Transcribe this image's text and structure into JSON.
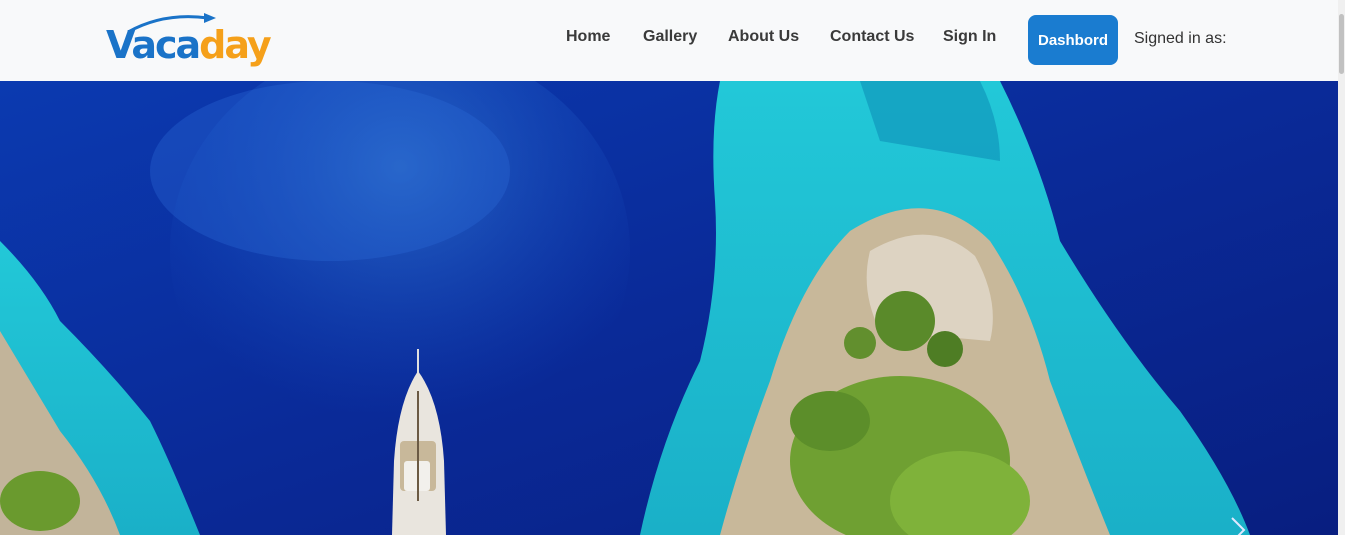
{
  "brand": {
    "name_part1": "Vaca",
    "name_part2": "day",
    "colors": {
      "primary": "#1a73c8",
      "accent": "#f5a01a"
    }
  },
  "nav": {
    "links": [
      "Home",
      "Gallery",
      "About Us",
      "Contact Us",
      "Sign In"
    ],
    "dashboard_label": "Dashbord",
    "signed_in_label": "Signed in as:"
  },
  "hero": {
    "image": "aerial-sea-island-yacht",
    "next_icon": "chevron-right-icon"
  },
  "colors": {
    "nav_bg": "#f8f9fa",
    "button_bg": "#1a7cd0",
    "deep_sea": "#0a2c9a",
    "lagoon": "#16c0d0"
  }
}
